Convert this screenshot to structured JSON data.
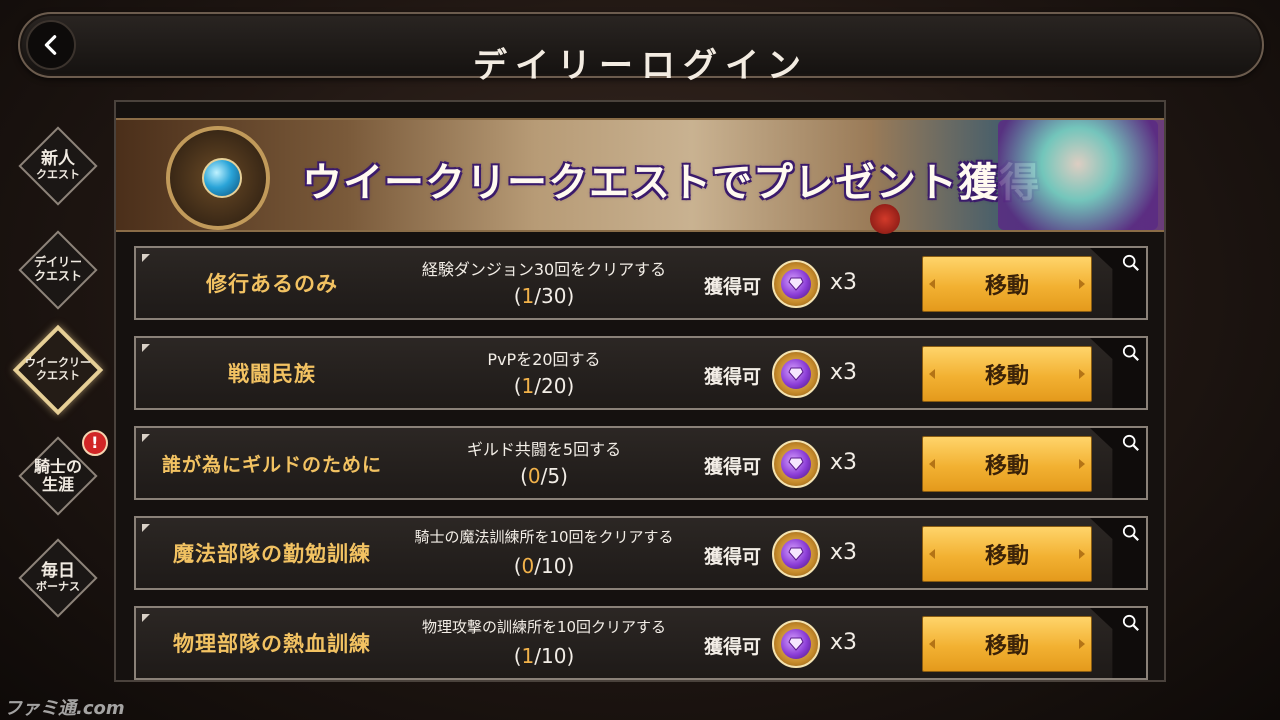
{
  "header": {
    "title": "デイリーログイン"
  },
  "side_tabs": [
    {
      "big": "新人",
      "small": "クエスト",
      "active": false
    },
    {
      "big": "",
      "small": "デイリー\nクエスト",
      "active": false
    },
    {
      "big": "",
      "small": "ウイークリー\nクエスト",
      "active": true
    },
    {
      "big": "騎士の\n生涯",
      "small": "",
      "active": false,
      "alert": "!"
    },
    {
      "big": "毎日",
      "small": "ボーナス",
      "active": false
    }
  ],
  "banner": {
    "text": "ウイークリークエストでプレゼント獲得"
  },
  "quests": [
    {
      "name": "修行あるのみ",
      "desc": "経験ダンジョン30回をクリアする",
      "cur": "1",
      "total": "/30)",
      "claim": "獲得可",
      "qty": "x3",
      "button": "移動"
    },
    {
      "name": "戦闘民族",
      "desc": "PvPを20回する",
      "cur": "1",
      "total": "/20)",
      "claim": "獲得可",
      "qty": "x3",
      "button": "移動"
    },
    {
      "name": "誰が為にギルドのために",
      "desc": "ギルド共闘を5回する",
      "cur": "0",
      "total": "/5)",
      "claim": "獲得可",
      "qty": "x3",
      "button": "移動"
    },
    {
      "name": "魔法部隊の勤勉訓練",
      "desc": "騎士の魔法訓練所を10回をクリアする",
      "cur": "0",
      "total": "/10)",
      "claim": "獲得可",
      "qty": "x3",
      "button": "移動"
    },
    {
      "name": "物理部隊の熱血訓練",
      "desc": "物理攻撃の訓練所を10回クリアする",
      "cur": "1",
      "total": "/10)",
      "claim": "獲得可",
      "qty": "x3",
      "button": "移動"
    }
  ],
  "watermark": "ファミ通.com"
}
